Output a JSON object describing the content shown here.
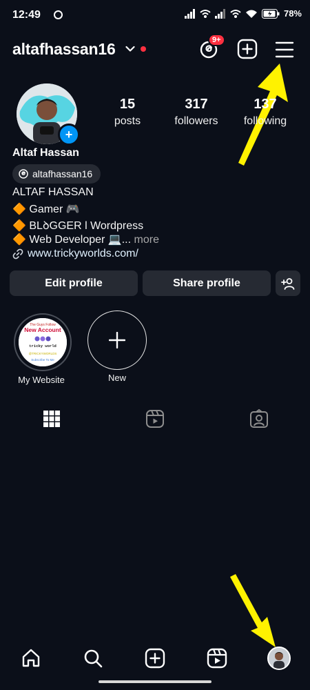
{
  "status_bar": {
    "time": "12:49",
    "battery": "78%"
  },
  "header": {
    "username": "altafhassan16",
    "notification_badge": "9+"
  },
  "profile": {
    "full_name": "Altaf Hassan",
    "threads_handle": "altafhassan16",
    "stats": [
      {
        "value": "15",
        "label": "posts"
      },
      {
        "value": "317",
        "label": "followers"
      },
      {
        "value": "137",
        "label": "following"
      }
    ],
    "bio": [
      "ALTAF HASSAN",
      "🔶 Gamer 🎮",
      "🔶 BLꝺGGER l Wordpress",
      "🔶 Web Developer 💻..."
    ],
    "bio_more": "more",
    "link": "www.trickyworlds.com/"
  },
  "buttons": {
    "edit_profile": "Edit profile",
    "share_profile": "Share profile"
  },
  "highlights": [
    {
      "label": "My Website",
      "caption_lines": [
        "The Guys Follow",
        "New Account",
        "tricky world",
        "@TRICKYWORLDS",
        "Subscribe To Me"
      ]
    },
    {
      "label": "New"
    }
  ],
  "colors": {
    "background": "#0b0f19",
    "button_bg": "#262a33",
    "accent_blue": "#0095f6",
    "badge_red": "#ff3040",
    "annotation_arrow": "#fff200"
  }
}
